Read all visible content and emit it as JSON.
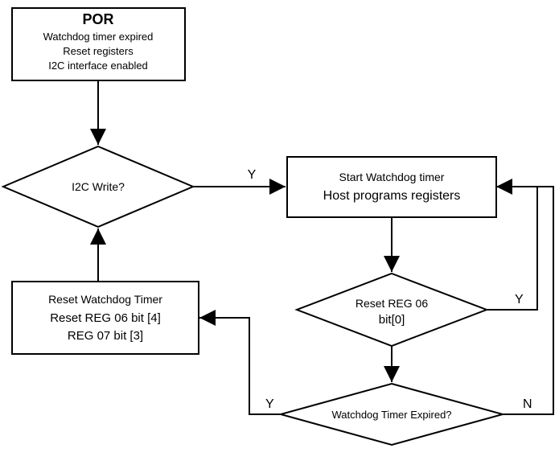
{
  "por": {
    "title": "POR",
    "line1": "Watchdog timer expired",
    "line2": "Reset registers",
    "line3": "I2C interface enabled"
  },
  "i2cWrite": {
    "label": "I2C Write?",
    "edgeY": "Y"
  },
  "startWatchdog": {
    "line1": "Start Watchdog timer",
    "line2": "Host programs registers"
  },
  "resetReg06": {
    "line1": "Reset REG 06",
    "line2": "bit[0]",
    "edgeY": "Y"
  },
  "resetWatchdog": {
    "line1": "Reset Watchdog Timer",
    "line2": "Reset REG 06 bit [4]",
    "line3": "REG 07 bit [3]"
  },
  "watchdogExpired": {
    "label": "Watchdog Timer Expired?",
    "edgeY": "Y",
    "edgeN": "N"
  },
  "chart_data": {
    "type": "flowchart",
    "nodes": [
      {
        "id": "por",
        "type": "process",
        "text": "POR / Watchdog timer expired / Reset registers / I2C interface enabled"
      },
      {
        "id": "i2c",
        "type": "decision",
        "text": "I2C Write?"
      },
      {
        "id": "start",
        "type": "process",
        "text": "Start Watchdog timer / Host programs registers"
      },
      {
        "id": "reset06",
        "type": "decision",
        "text": "Reset REG 06 bit[0]"
      },
      {
        "id": "expired",
        "type": "decision",
        "text": "Watchdog Timer Expired?"
      },
      {
        "id": "resetwd",
        "type": "process",
        "text": "Reset Watchdog Timer / Reset REG 06 bit [4] / REG 07 bit [3]"
      }
    ],
    "edges": [
      {
        "from": "por",
        "to": "i2c"
      },
      {
        "from": "i2c",
        "to": "start",
        "label": "Y"
      },
      {
        "from": "start",
        "to": "reset06"
      },
      {
        "from": "reset06",
        "to": "start",
        "label": "Y",
        "via": "right-loop"
      },
      {
        "from": "reset06",
        "to": "expired"
      },
      {
        "from": "expired",
        "to": "resetwd",
        "label": "Y"
      },
      {
        "from": "expired",
        "to": "start",
        "label": "N",
        "via": "right-loop"
      },
      {
        "from": "resetwd",
        "to": "i2c"
      }
    ]
  }
}
